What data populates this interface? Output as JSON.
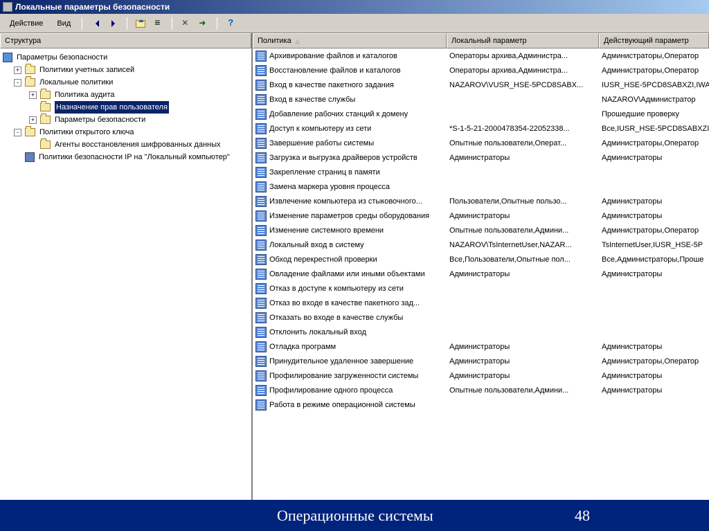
{
  "window": {
    "title": "Локальные параметры безопасности"
  },
  "menu": {
    "action": "Действие",
    "view": "Вид"
  },
  "tree": {
    "header": "Структура",
    "root": "Параметры безопасности",
    "items": [
      {
        "label": "Политики учетных записей",
        "exp": "+",
        "indent": 1,
        "type": "folder"
      },
      {
        "label": "Локальные политики",
        "exp": "-",
        "indent": 1,
        "type": "folder"
      },
      {
        "label": "Политика аудита",
        "exp": "+",
        "indent": 2,
        "type": "folder"
      },
      {
        "label": "Назначение прав пользователя",
        "exp": "",
        "indent": 2,
        "type": "folder",
        "selected": true
      },
      {
        "label": "Параметры безопасности",
        "exp": "+",
        "indent": 2,
        "type": "folder"
      },
      {
        "label": "Политики открытого ключа",
        "exp": "-",
        "indent": 1,
        "type": "folder"
      },
      {
        "label": "Агенты восстановления шифрованных данных",
        "exp": "",
        "indent": 2,
        "type": "folder"
      },
      {
        "label": "Политики безопасности IP на \"Локальный компьютер\"",
        "exp": "",
        "indent": 1,
        "type": "ip"
      }
    ]
  },
  "list": {
    "columns": {
      "policy": "Политика",
      "local": "Локальный параметр",
      "effective": "Действующий параметр"
    },
    "rows": [
      {
        "p": "Архивирование файлов и каталогов",
        "l": "Операторы архива,Администра...",
        "e": "Администраторы,Оператор"
      },
      {
        "p": "Восстановление файлов и каталогов",
        "l": "Операторы архива,Администра...",
        "e": "Администраторы,Оператор"
      },
      {
        "p": "Вход в качестве пакетного задания",
        "l": "NAZAROV\\VUSR_HSE-5PCD8SABX...",
        "e": "IUSR_HSE-5PCD8SABXZI,IWA"
      },
      {
        "p": "Вход в качестве службы",
        "l": "",
        "e": "NAZAROV\\Администратор"
      },
      {
        "p": "Добавление рабочих станций к домену",
        "l": "",
        "e": "Прошедшие проверку"
      },
      {
        "p": "Доступ к компьютеру из сети",
        "l": "*S-1-5-21-2000478354-22052338...",
        "e": "Все,IUSR_HSE-5PCD8SABXZI"
      },
      {
        "p": "Завершение работы системы",
        "l": "Опытные пользователи,Операт...",
        "e": "Администраторы,Оператор"
      },
      {
        "p": "Загрузка и выгрузка драйверов устройств",
        "l": "Администраторы",
        "e": "Администраторы"
      },
      {
        "p": "Закрепление страниц в памяти",
        "l": "",
        "e": ""
      },
      {
        "p": "Замена маркера уровня процесса",
        "l": "",
        "e": ""
      },
      {
        "p": "Извлечение компьютера из стыковочного...",
        "l": "Пользователи,Опытные пользо...",
        "e": "Администраторы"
      },
      {
        "p": "Изменение параметров среды оборудования",
        "l": "Администраторы",
        "e": "Администраторы"
      },
      {
        "p": "Изменение системного времени",
        "l": "Опытные пользователи,Админи...",
        "e": "Администраторы,Оператор"
      },
      {
        "p": "Локальный вход в систему",
        "l": "NAZAROV\\TsInternetUser,NAZAR...",
        "e": "TsInternetUser,IUSR_HSE-5P"
      },
      {
        "p": "Обход перекрестной проверки",
        "l": "Все,Пользователи,Опытные пол...",
        "e": "Все,Администраторы,Проше"
      },
      {
        "p": "Овладение файлами или иными объектами",
        "l": "Администраторы",
        "e": "Администраторы"
      },
      {
        "p": "Отказ в доступе к компьютеру из сети",
        "l": "",
        "e": ""
      },
      {
        "p": "Отказ во входе в качестве пакетного зад...",
        "l": "",
        "e": ""
      },
      {
        "p": "Отказать во входе в качестве службы",
        "l": "",
        "e": ""
      },
      {
        "p": "Отклонить локальный вход",
        "l": "",
        "e": ""
      },
      {
        "p": "Отладка программ",
        "l": "Администраторы",
        "e": "Администраторы"
      },
      {
        "p": "Принудительное удаленное завершение",
        "l": "Администраторы",
        "e": "Администраторы,Оператор"
      },
      {
        "p": "Профилирование загруженности системы",
        "l": "Администраторы",
        "e": "Администраторы"
      },
      {
        "p": "Профилирование одного процесса",
        "l": "Опытные пользователи,Админи...",
        "e": "Администраторы"
      },
      {
        "p": "Работа в режиме операционной системы",
        "l": "",
        "e": ""
      }
    ]
  },
  "footer": {
    "title": "Операционные системы",
    "page": "48"
  }
}
